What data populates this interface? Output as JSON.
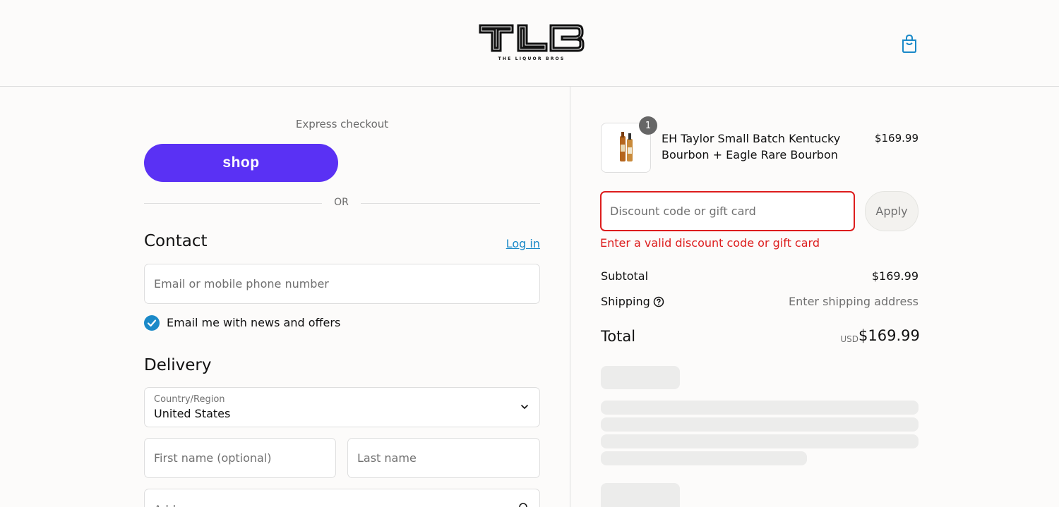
{
  "header": {
    "logo_text": "TLB",
    "logo_subtitle": "THE LIQUOR BROS",
    "cart_icon": "shopping-bag-icon"
  },
  "express": {
    "title": "Express checkout",
    "shop_button_label": "shop",
    "or_label": "OR"
  },
  "contact": {
    "heading": "Contact",
    "login_label": "Log in",
    "email_placeholder": "Email or mobile phone number",
    "newsletter_label": "Email me with news and offers",
    "newsletter_checked": true
  },
  "delivery": {
    "heading": "Delivery",
    "country_label": "Country/Region",
    "country_value": "United States",
    "first_name_placeholder": "First name (optional)",
    "last_name_placeholder": "Last name",
    "address_placeholder": "Address"
  },
  "order": {
    "item": {
      "quantity": "1",
      "name": "EH Taylor Small Batch Kentucky Bourbon + Eagle Rare Bourbon",
      "price": "$169.99"
    },
    "discount_placeholder": "Discount code or gift card",
    "apply_label": "Apply",
    "discount_error": "Enter a valid discount code or gift card",
    "subtotal_label": "Subtotal",
    "subtotal_value": "$169.99",
    "shipping_label": "Shipping",
    "shipping_value": "Enter shipping address",
    "total_label": "Total",
    "total_currency": "USD",
    "total_value": "$169.99"
  },
  "colors": {
    "shop_purple": "#5a31f4",
    "accent_blue": "#1a89c8",
    "error_red": "#dd1d1d"
  }
}
